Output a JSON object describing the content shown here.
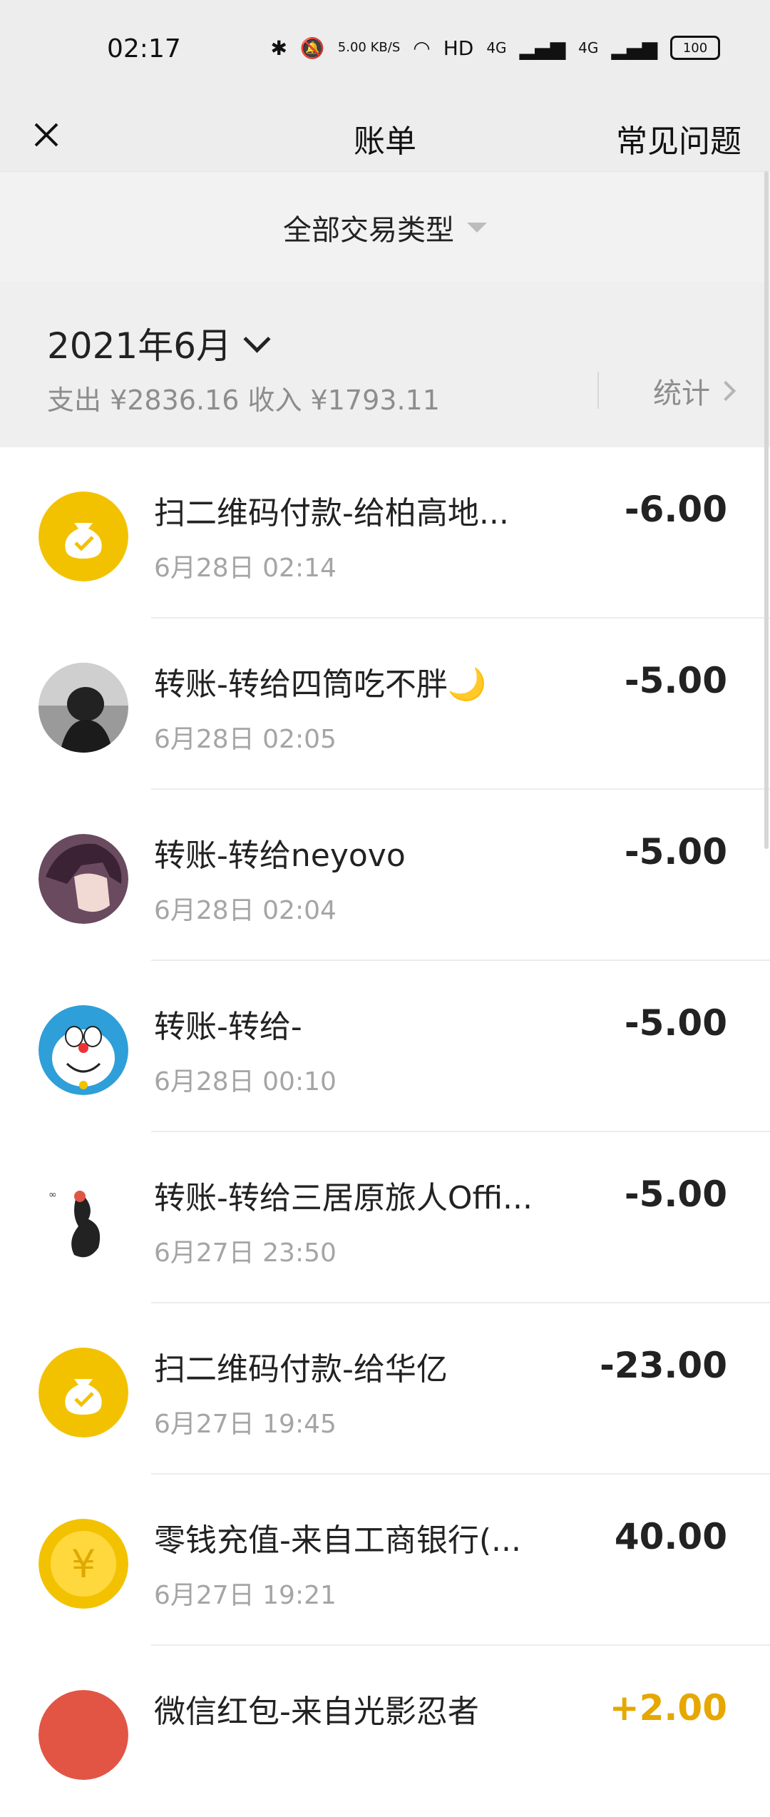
{
  "status": {
    "time": "02:17",
    "speed": "5.00 KB/S",
    "hd": "HD",
    "net1": "4G",
    "net2": "4G",
    "battery": "100"
  },
  "nav": {
    "title": "账单",
    "faq": "常见问题"
  },
  "filter": {
    "label": "全部交易类型"
  },
  "summary": {
    "month": "2021年6月",
    "totals": "支出 ¥2836.16 收入 ¥1793.11",
    "stats": "统计"
  },
  "transactions": [
    {
      "title": "扫二维码付款-给柏高地...",
      "date": "6月28日 02:14",
      "amount": "-6.00",
      "icon": "money-bag-icon"
    },
    {
      "title": "转账-转给四筒吃不胖🌙",
      "date": "6月28日 02:05",
      "amount": "-5.00",
      "icon": "avatar"
    },
    {
      "title": "转账-转给neyovo",
      "date": "6月28日 02:04",
      "amount": "-5.00",
      "icon": "avatar"
    },
    {
      "title": "转账-转给-",
      "date": "6月28日 00:10",
      "amount": "-5.00",
      "icon": "avatar"
    },
    {
      "title": "转账-转给三居原旅人Offi...",
      "date": "6月27日 23:50",
      "amount": "-5.00",
      "icon": "avatar"
    },
    {
      "title": "扫二维码付款-给华亿",
      "date": "6月27日 19:45",
      "amount": "-23.00",
      "icon": "money-bag-icon"
    },
    {
      "title": "零钱充值-来自工商银行(...",
      "date": "6月27日 19:21",
      "amount": "40.00",
      "icon": "yen-coin-icon"
    },
    {
      "title": "微信红包-来自光影忍者",
      "date": "",
      "amount": "+2.00",
      "icon": "red-packet-icon"
    }
  ],
  "colors": {
    "accent_yellow": "#f2c200",
    "income": "#e6a700",
    "red_packet": "#e25545"
  }
}
